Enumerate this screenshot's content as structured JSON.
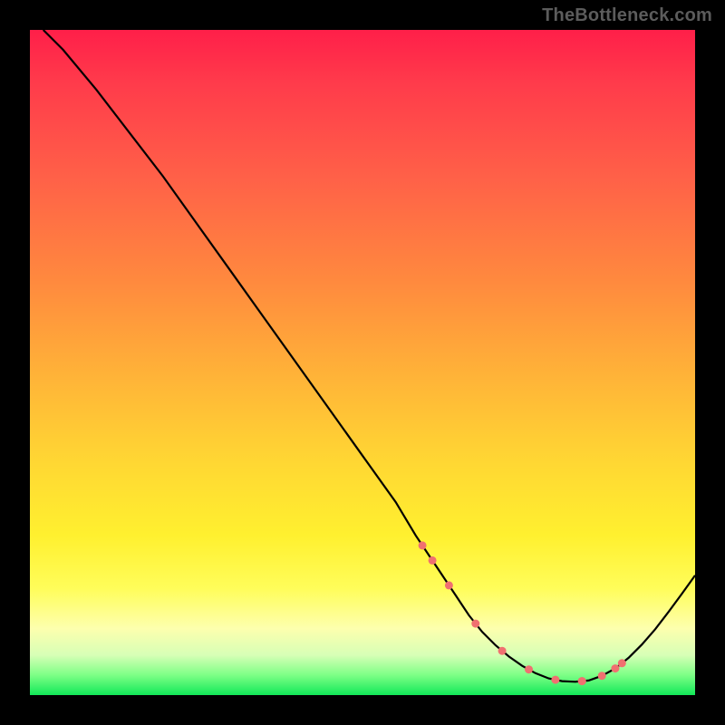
{
  "watermark": "TheBottleneck.com",
  "chart_data": {
    "type": "line",
    "title": "",
    "xlabel": "",
    "ylabel": "",
    "xlim": [
      0,
      100
    ],
    "ylim": [
      0,
      100
    ],
    "series": [
      {
        "name": "curve",
        "x": [
          2,
          5,
          10,
          15,
          20,
          25,
          30,
          35,
          40,
          45,
          50,
          55,
          58,
          60,
          62,
          64,
          66,
          68,
          70,
          72,
          74,
          76,
          78,
          80,
          82,
          84,
          86,
          88,
          90,
          92,
          94,
          96,
          98,
          100
        ],
        "values": [
          100,
          97,
          91,
          84.5,
          78,
          71,
          64,
          57,
          50,
          43,
          36,
          29,
          24,
          21,
          18,
          15,
          12,
          9.5,
          7.5,
          5.8,
          4.4,
          3.3,
          2.5,
          2.1,
          2.0,
          2.2,
          2.9,
          4.0,
          5.6,
          7.6,
          9.9,
          12.5,
          15.2,
          18.0
        ]
      }
    ],
    "dotted_range_x": [
      59,
      89
    ],
    "dot_color": "#f07070",
    "curve_color": "#000000"
  }
}
